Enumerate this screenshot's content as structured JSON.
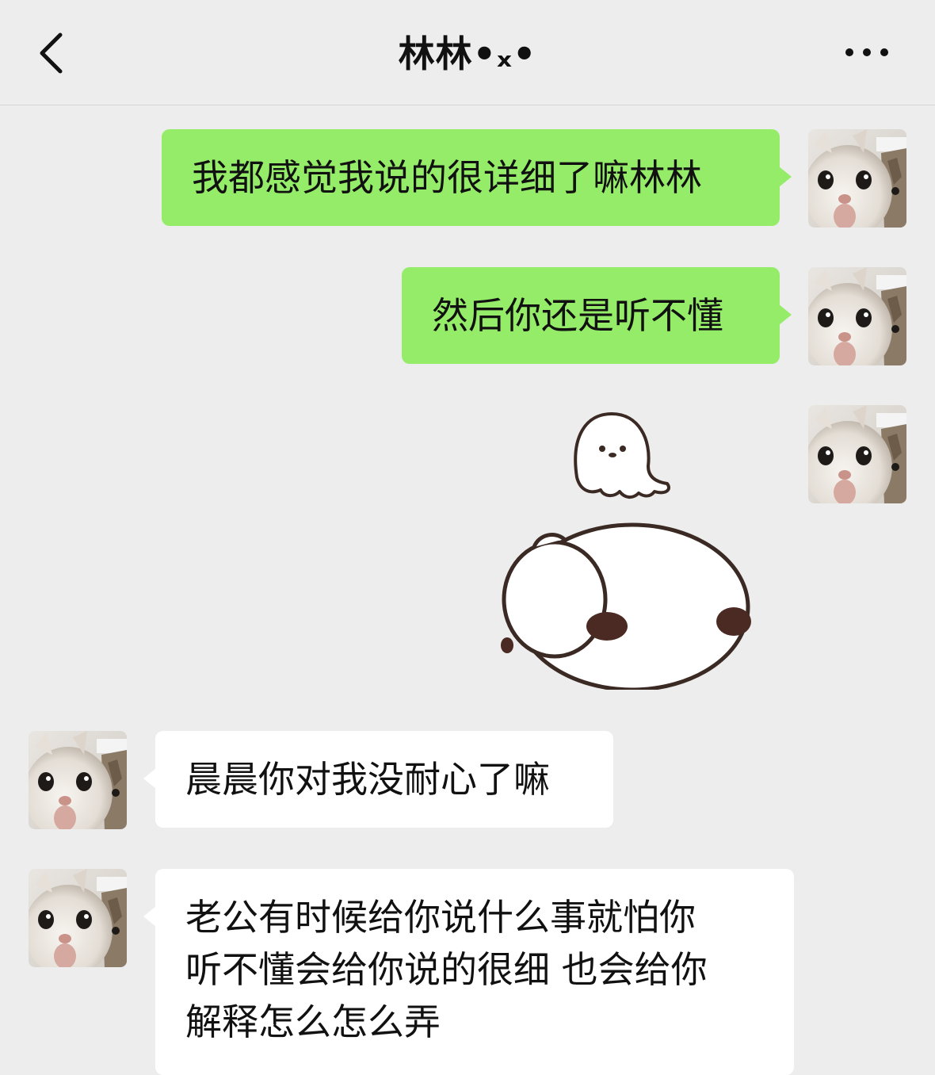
{
  "header": {
    "title": "林林•ₓ•",
    "back_icon": "chevron-left-icon",
    "more_icon": "more-dots-icon"
  },
  "messages": [
    {
      "side": "right",
      "type": "text",
      "text": "我都感觉我说的很详细了嘛林林"
    },
    {
      "side": "right",
      "type": "text",
      "text": "然后你还是听不懂"
    },
    {
      "side": "right",
      "type": "sticker",
      "sticker": "ghost-and-bun-sticker"
    },
    {
      "side": "left",
      "type": "text",
      "text": "晨晨你对我没耐心了嘛"
    },
    {
      "side": "left",
      "type": "text",
      "lines": [
        "老公有时候给你说什么事就怕你",
        "听不懂会给你说的很细  也会给你",
        "解释怎么怎么弄"
      ]
    }
  ],
  "colors": {
    "background": "#ededed",
    "sent_bubble": "#95ec69",
    "received_bubble": "#ffffff"
  }
}
